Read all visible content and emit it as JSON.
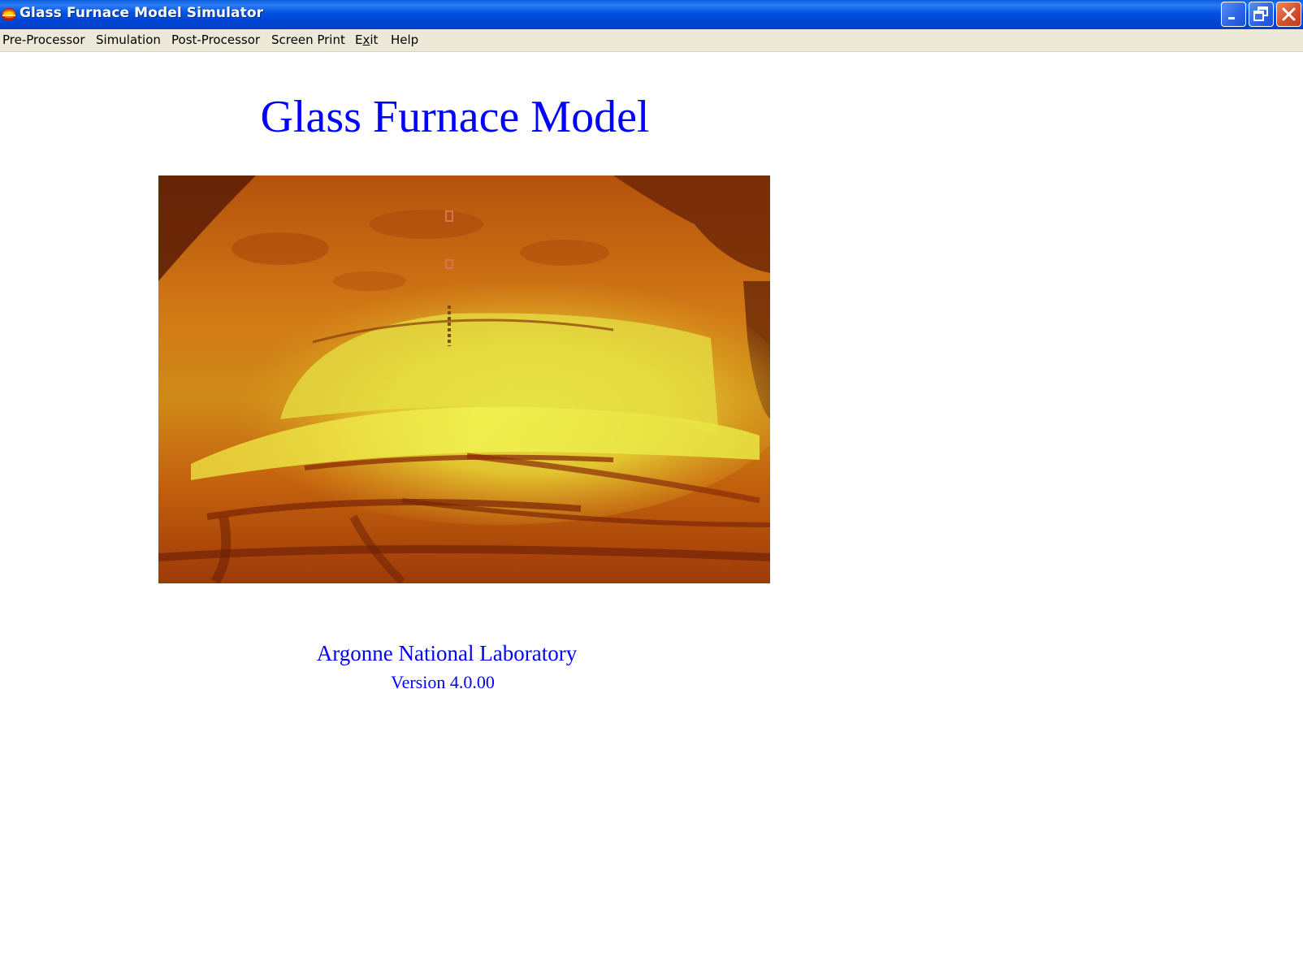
{
  "window": {
    "title": "Glass Furnace Model Simulator",
    "controls": [
      "minimize",
      "restore",
      "close"
    ]
  },
  "menu": {
    "pre_processor": "Pre-Processor",
    "simulation": "Simulation",
    "post_processor": "Post-Processor",
    "screen_print": "Screen Print",
    "exit": {
      "before": "E",
      "underlined": "x",
      "after": "it"
    },
    "help": "Help"
  },
  "main": {
    "title": "Glass Furnace Model",
    "organization": "Argonne National Laboratory",
    "version": "Version 4.0.00",
    "image": "furnace-interior-photo"
  },
  "colors": {
    "titlebar": "#0052e0",
    "menubar": "#ece9d8",
    "heading_text": "#0000ff",
    "background": "#ffffff"
  }
}
